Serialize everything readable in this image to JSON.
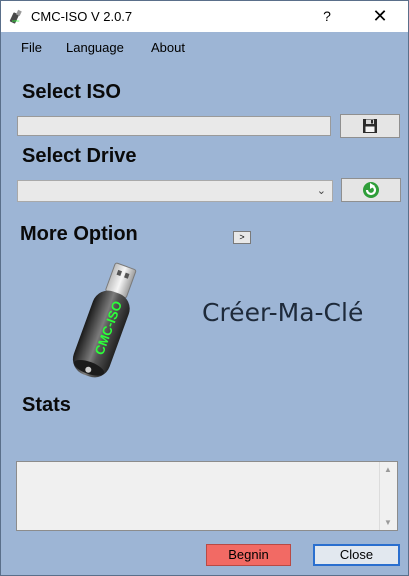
{
  "window": {
    "title": "CMC-ISO  V 2.0.7",
    "help_glyph": "?",
    "close_glyph": "✕"
  },
  "menu": {
    "file": "File",
    "language": "Language",
    "about": "About"
  },
  "sections": {
    "select_iso": "Select ISO",
    "select_drive": "Select Drive",
    "more_option": "More Option",
    "stats": "Stats"
  },
  "iso": {
    "path": "",
    "browse_icon": "floppy-disk-icon"
  },
  "drive": {
    "selected": "",
    "refresh_icon": "refresh-icon",
    "chevron": "⌄"
  },
  "more_option_toggle": ">",
  "usb_label": "CMC-ISO",
  "brand": "Créer-Ma-Clé",
  "log": {
    "text": ""
  },
  "buttons": {
    "begin": "Begnin",
    "close": "Close"
  },
  "colors": {
    "background": "#9db5d5",
    "begin_button": "#f26a64",
    "close_border": "#2a6fcf",
    "usb_text": "#2cff3a"
  }
}
